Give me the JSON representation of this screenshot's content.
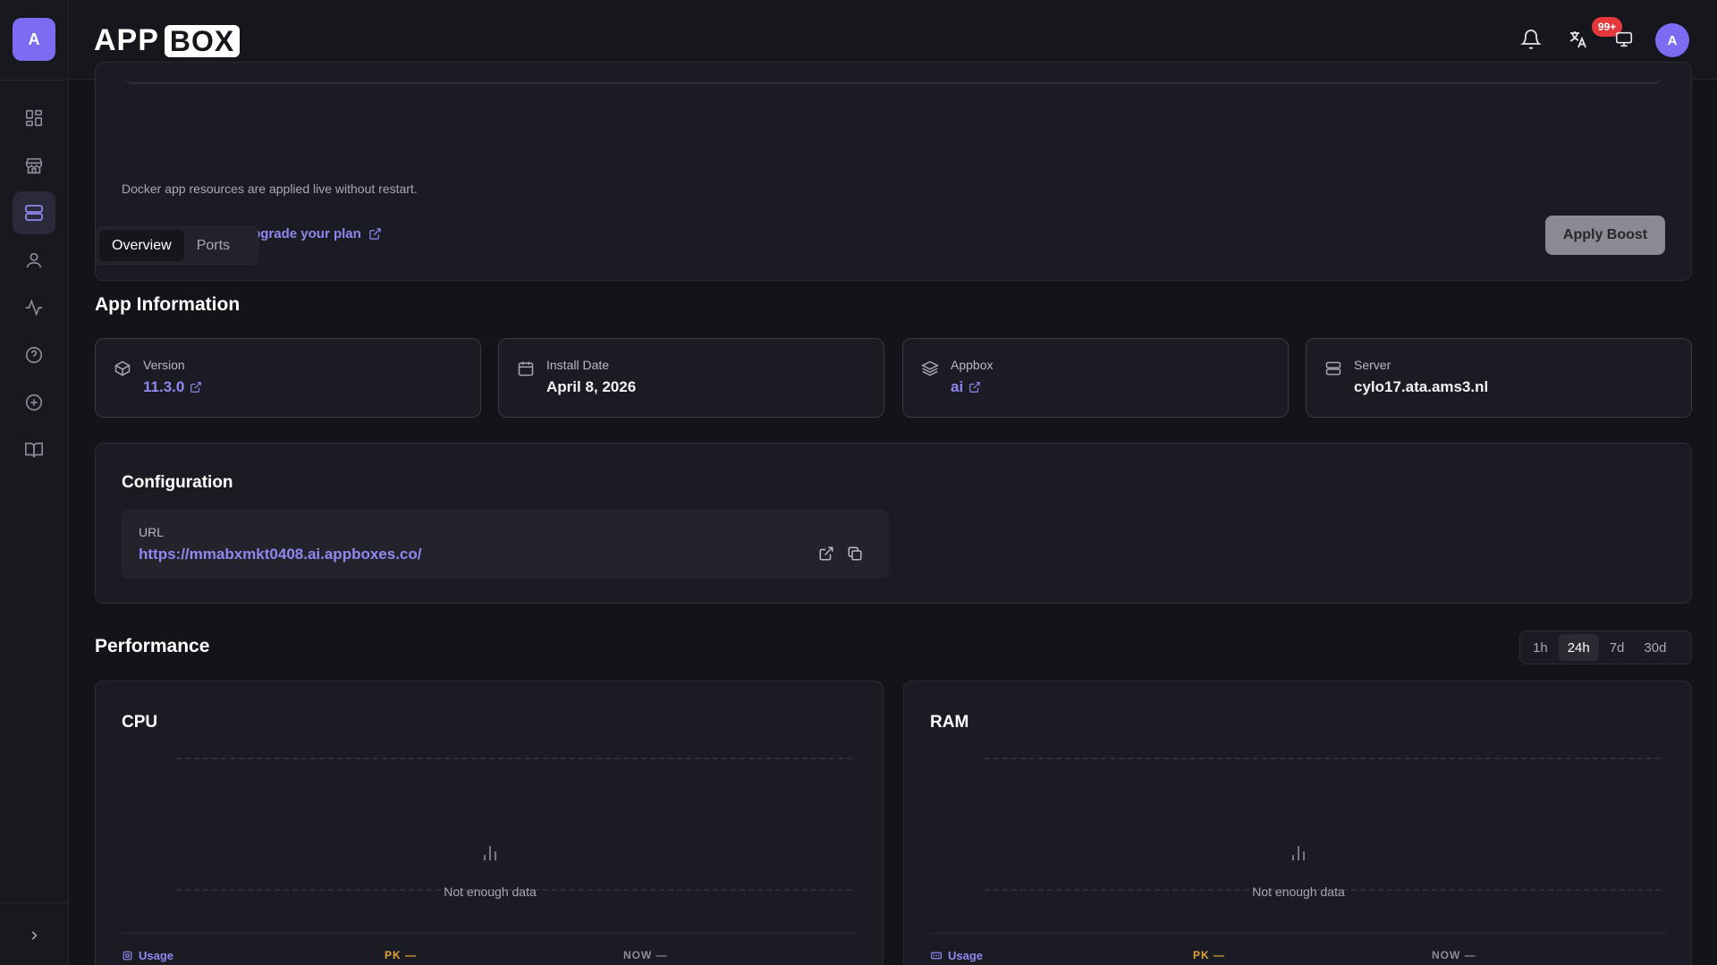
{
  "brand": {
    "part1": "APP",
    "part2": "BOX"
  },
  "sidebar": {
    "logo_letter": "A",
    "items": [
      {
        "name": "dashboard",
        "icon": "dashboard-grid-icon"
      },
      {
        "name": "store",
        "icon": "store-icon"
      },
      {
        "name": "servers",
        "icon": "server-icon",
        "active": true
      },
      {
        "name": "account",
        "icon": "user-icon"
      },
      {
        "name": "activity",
        "icon": "activity-icon"
      },
      {
        "name": "help",
        "icon": "help-circle-icon"
      },
      {
        "name": "add",
        "icon": "plus-circle-icon"
      },
      {
        "name": "docs",
        "icon": "book-icon"
      }
    ]
  },
  "topbar": {
    "notification_badge": "99+",
    "avatar_letter": "A"
  },
  "boost": {
    "note": "Docker app resources are applied live without restart.",
    "upgrade_link": "Want more boost? Upgrade your plan",
    "apply_label": "Apply Boost"
  },
  "tabs": [
    {
      "label": "Overview",
      "active": true
    },
    {
      "label": "Ports",
      "active": false
    }
  ],
  "app_info": {
    "title": "App Information",
    "cards": [
      {
        "label": "Version",
        "value": "11.3.0",
        "link": true
      },
      {
        "label": "Install Date",
        "value": "April 8, 2026",
        "link": false
      },
      {
        "label": "Appbox",
        "value": "ai",
        "link": true
      },
      {
        "label": "Server",
        "value": "cylo17.ata.ams3.nl",
        "link": false
      }
    ]
  },
  "configuration": {
    "title": "Configuration",
    "url_label": "URL",
    "url_value": "https://mmabxmkt0408.ai.appboxes.co/"
  },
  "performance": {
    "title": "Performance",
    "ranges": [
      "1h",
      "24h",
      "7d",
      "30d"
    ],
    "active_range": "24h",
    "charts": [
      {
        "title": "CPU",
        "empty_text": "Not enough data",
        "legend_usage": "Usage",
        "legend_pk": "PK —",
        "legend_now": "NOW —"
      },
      {
        "title": "RAM",
        "empty_text": "Not enough data",
        "legend_usage": "Usage",
        "legend_pk": "PK —",
        "legend_now": "NOW —"
      }
    ]
  },
  "colors": {
    "accent": "#8f88f0",
    "background": "#13131a",
    "card": "#1b1b23",
    "badge": "#e5383b",
    "peak": "#e2a33c"
  }
}
